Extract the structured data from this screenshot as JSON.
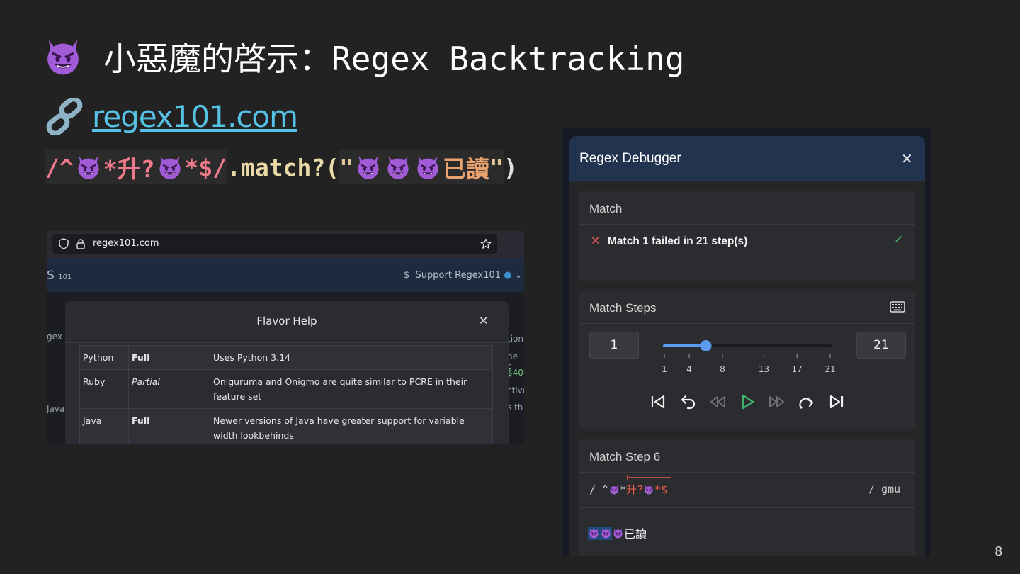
{
  "slide": {
    "title": "小惡魔的啓示：Regex Backtracking",
    "link_text": "regex101.com",
    "code": {
      "regex_open": "/^",
      "regex_mid1": "*升?",
      "regex_mid2": "*$/",
      "method": ".match?(",
      "quote_open": "\"",
      "zh": "已讀",
      "quote_close": "\"",
      "paren_close": ")"
    },
    "page_number": "8"
  },
  "left_screenshot": {
    "url": "regex101.com",
    "logo": "S",
    "logo_sub": "101",
    "support_text": "Support Regex101",
    "modal_title": "Flavor Help",
    "close_glyph": "✕",
    "edge_left": [
      "gex",
      "JavaS"
    ],
    "edge_right": [
      "tion",
      "he c",
      "$40?",
      "ctive",
      "s th"
    ],
    "rows": [
      {
        "flavor": "Python",
        "support": "Full",
        "note": "Uses Python 3.14",
        "style": "full"
      },
      {
        "flavor": "Ruby",
        "support": "Partial",
        "note": "Oniguruma and Onigmo are quite similar to PCRE in their feature set",
        "style": "partial"
      },
      {
        "flavor": "Java",
        "support": "Full",
        "note": "Newer versions of Java have greater support for variable width lookbehinds",
        "style": "full"
      }
    ]
  },
  "debugger": {
    "title": "Regex Debugger",
    "close_glyph": "✕",
    "match_header": "Match",
    "match_status": "Match 1 failed in 21 step(s)",
    "match_fail_glyph": "✕",
    "match_check_glyph": "✓",
    "steps_header": "Match Steps",
    "step_min": "1",
    "step_max": "21",
    "slider_value": 6,
    "ticks": [
      "1",
      "4",
      "8",
      "13",
      "17",
      "21"
    ],
    "tick_values": [
      1,
      4,
      8,
      13,
      17,
      21
    ],
    "step_header": "Match Step 6",
    "regex_prefix": "/ ^",
    "regex_star1": "*",
    "regex_red": "升?",
    "regex_red_star": "*$",
    "regex_flags": "/ gmu",
    "test_suffix": "已讀"
  },
  "colors": {
    "accent_link": "#56c2e6",
    "regex_pink": "#ef7a8a",
    "slider_blue": "#5b9cf0",
    "play_green": "#41b36a",
    "fail_red": "#e35a5a"
  }
}
